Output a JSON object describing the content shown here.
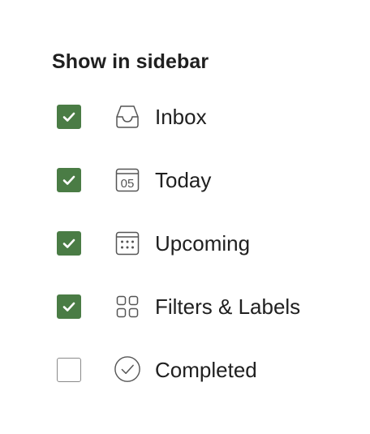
{
  "sidebar_settings": {
    "title": "Show in sidebar",
    "items": [
      {
        "label": "Inbox",
        "checked": true,
        "icon": "inbox-icon"
      },
      {
        "label": "Today",
        "checked": true,
        "icon": "calendar-today-icon",
        "icon_text": "05"
      },
      {
        "label": "Upcoming",
        "checked": true,
        "icon": "calendar-upcoming-icon"
      },
      {
        "label": "Filters & Labels",
        "checked": true,
        "icon": "grid-icon"
      },
      {
        "label": "Completed",
        "checked": false,
        "icon": "check-circle-icon"
      }
    ]
  },
  "colors": {
    "checked_fill": "#4a7c45",
    "text": "#202020",
    "icon_stroke": "#555555",
    "unchecked_border": "#8a8a8a"
  }
}
